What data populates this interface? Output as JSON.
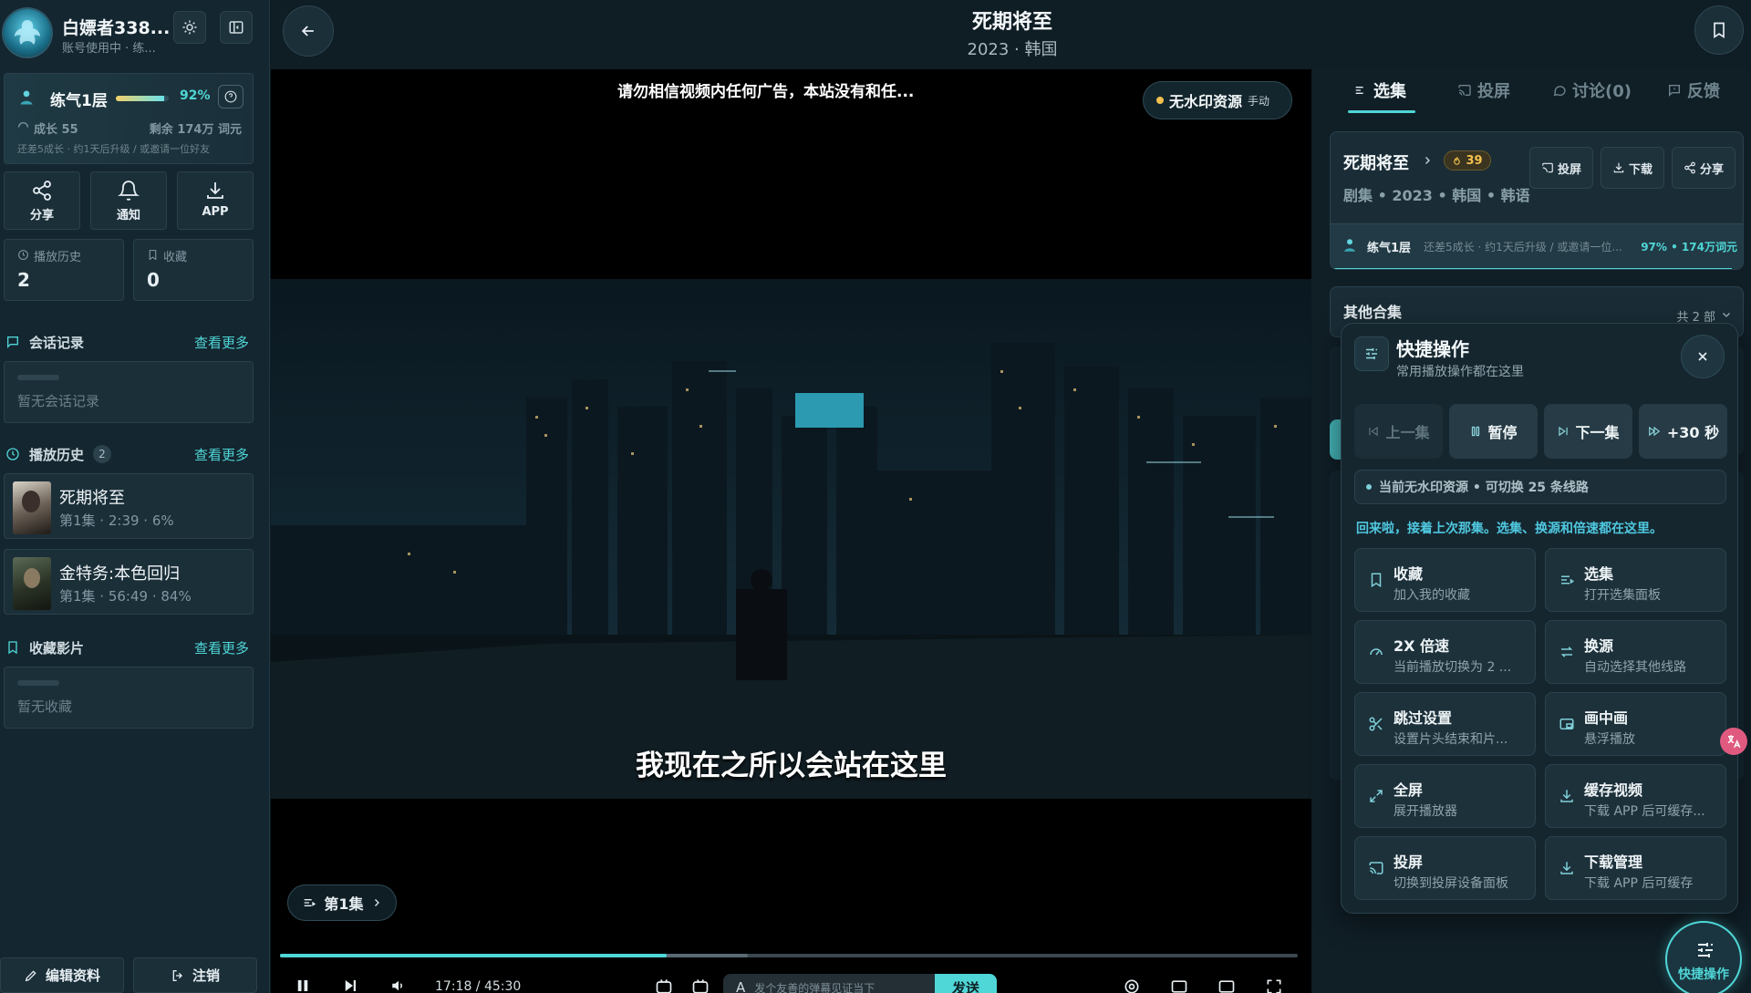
{
  "user": {
    "name": "白嫖者338...",
    "subtitle": "账号使用中 · 练..."
  },
  "level": {
    "name": "练气1层",
    "percent_text": "92%",
    "progress": 0.92,
    "growth": "成长 55",
    "remaining": "剩余 174万 词元",
    "hint": "还差5成长 · 约1天后升级 / 或邀请一位好友"
  },
  "quick_buttons": [
    {
      "label": "分享"
    },
    {
      "label": "通知"
    },
    {
      "label": "APP"
    }
  ],
  "stats": [
    {
      "label": "播放历史",
      "value": "2"
    },
    {
      "label": "收藏",
      "value": "0"
    }
  ],
  "chat": {
    "title": "会话记录",
    "more": "查看更多",
    "empty": "暂无会话记录"
  },
  "history": {
    "title": "播放历史",
    "count": "2",
    "more": "查看更多",
    "items": [
      {
        "title": "死期将至",
        "meta": "第1集 · 2:39 · 6%"
      },
      {
        "title": "金特务:本色回归",
        "meta": "第1集 · 56:49 · 84%"
      }
    ]
  },
  "favorites": {
    "title": "收藏影片",
    "more": "查看更多",
    "empty": "暂无收藏"
  },
  "bottom_buttons": {
    "edit": "编辑资料",
    "logout": "注销"
  },
  "header": {
    "title": "死期将至",
    "subtitle": "2023 · 韩国"
  },
  "player": {
    "notice": "请勿相信视频内任何广告，本站没有和任...",
    "badge": "无水印资源",
    "badge_mode": "手动",
    "subtitle": "我现在之所以会站在这里",
    "episode_chip": "第1集",
    "progress": 0.38,
    "time": "17:18 / 45:30",
    "danmaku_placeholder": "发个友善的弹幕见证当下",
    "send": "发送"
  },
  "tabs": [
    {
      "label": "选集"
    },
    {
      "label": "投屏"
    },
    {
      "label": "讨论(0)"
    },
    {
      "label": "反馈"
    }
  ],
  "show": {
    "title": "死期将至",
    "heat": "39",
    "meta": "剧集 • 2023 • 韩国 • 韩语",
    "actions": [
      {
        "label": "投屏"
      },
      {
        "label": "下载"
      },
      {
        "label": "分享"
      }
    ],
    "level_name": "练气1层",
    "level_hint": "还差5成长 · 约1天后升级 / 或邀请一位...",
    "level_right": "97% • 174万词元"
  },
  "other": {
    "title": "其他合集",
    "count": "共 2 部"
  },
  "quick_panel": {
    "title": "快捷操作",
    "subtitle": "常用播放操作都在这里",
    "controls": [
      {
        "label": "上一集"
      },
      {
        "label": "暂停"
      },
      {
        "label": "下一集"
      },
      {
        "label": "+30 秒"
      }
    ],
    "source_status": "当前无水印资源 • 可切换 25 条线路",
    "welcome": "回来啦，接着上次那集。选集、换源和倍速都在这里。",
    "tiles": [
      {
        "title": "收藏",
        "desc": "加入我的收藏",
        "icon": "bookmark-icon"
      },
      {
        "title": "选集",
        "desc": "打开选集面板",
        "icon": "list-icon"
      },
      {
        "title": "2X 倍速",
        "desc": "当前播放切换为 2 ...",
        "icon": "speed-icon"
      },
      {
        "title": "换源",
        "desc": "自动选择其他线路",
        "icon": "swap-icon"
      },
      {
        "title": "跳过设置",
        "desc": "设置片头结束和片...",
        "icon": "scissors-icon"
      },
      {
        "title": "画中画",
        "desc": "悬浮播放",
        "icon": "pip-icon"
      },
      {
        "title": "全屏",
        "desc": "展开播放器",
        "icon": "expand-icon"
      },
      {
        "title": "缓存视频",
        "desc": "下载 APP 后可缓存...",
        "icon": "download-icon"
      },
      {
        "title": "投屏",
        "desc": "切换到投屏设备面板",
        "icon": "cast-icon"
      },
      {
        "title": "下载管理",
        "desc": "下载 APP 后可缓存",
        "icon": "download-icon"
      }
    ]
  },
  "fab_label": "快捷操作",
  "colors": {
    "accent": "#4fd6d6",
    "background": "#0f1d25",
    "panel": "#1b2f39",
    "gold": "#f2c14e"
  }
}
